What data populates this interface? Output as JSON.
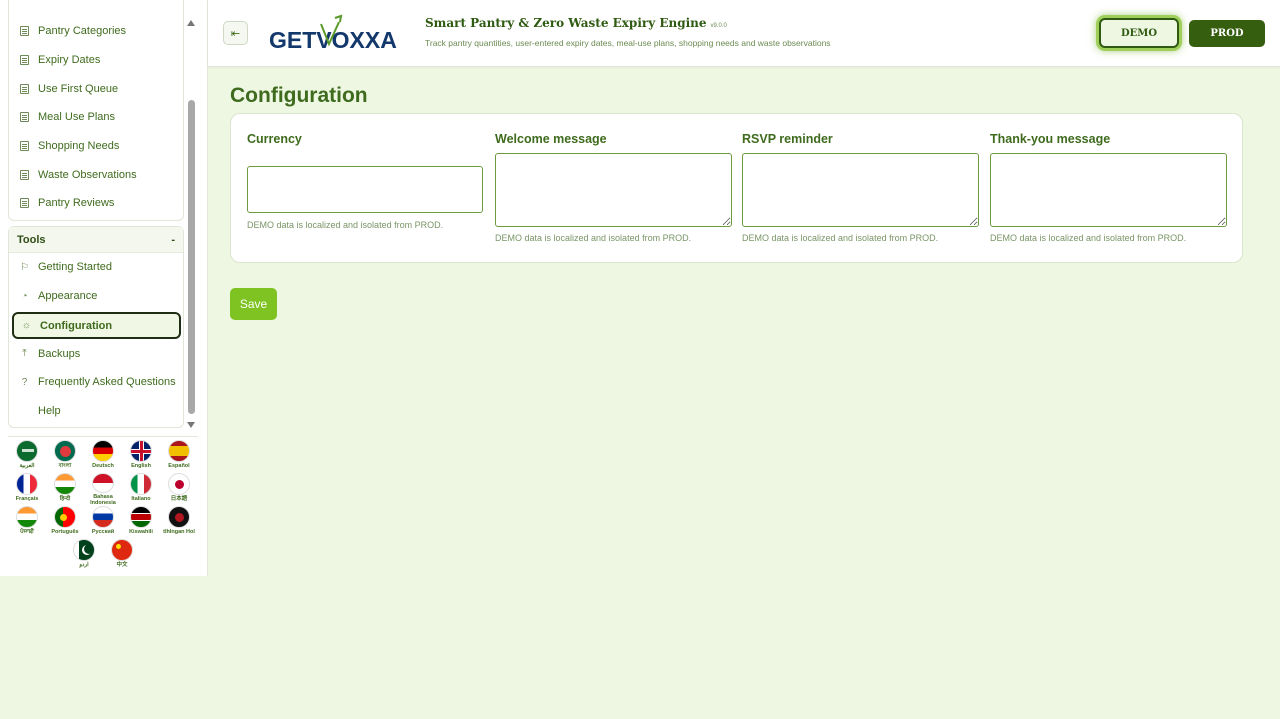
{
  "sidebar": {
    "items": [
      {
        "label": "Pantry Categories"
      },
      {
        "label": "Expiry Dates"
      },
      {
        "label": "Use First Queue"
      },
      {
        "label": "Meal Use Plans"
      },
      {
        "label": "Shopping Needs"
      },
      {
        "label": "Waste Observations"
      },
      {
        "label": "Pantry Reviews"
      }
    ],
    "tools": {
      "title": "Tools",
      "toggle": "-",
      "items": [
        {
          "label": "Getting Started"
        },
        {
          "label": "Appearance"
        },
        {
          "label": "Configuration"
        },
        {
          "label": "Backups"
        },
        {
          "label": "Frequently Asked Questions"
        },
        {
          "label": "Help"
        }
      ]
    },
    "languages": [
      {
        "label": "العربية"
      },
      {
        "label": "বাংলা"
      },
      {
        "label": "Deutsch"
      },
      {
        "label": "English"
      },
      {
        "label": "Español"
      },
      {
        "label": "Français"
      },
      {
        "label": "हिन्दी"
      },
      {
        "label": "Bahasa Indonesia"
      },
      {
        "label": "Italiano"
      },
      {
        "label": "日本語"
      },
      {
        "label": "ਪੰਜਾਬੀ"
      },
      {
        "label": "Português"
      },
      {
        "label": "Русский"
      },
      {
        "label": "Kiswahili"
      },
      {
        "label": "tlhIngan Hol"
      },
      {
        "label": "اردو"
      },
      {
        "label": "中文"
      }
    ]
  },
  "header": {
    "logo_text": "GETVOXXA",
    "title": "Smart Pantry & Zero Waste Expiry Engine",
    "version": "v9.0.0",
    "subtitle": "Track pantry quantities, user-entered expiry dates, meal-use plans, shopping needs and waste observations",
    "env_demo": "DEMO",
    "env_prod": "PROD"
  },
  "main": {
    "title": "Configuration",
    "fields": [
      {
        "label": "Currency",
        "value": "",
        "hint": "DEMO data is localized and isolated from PROD."
      },
      {
        "label": "Welcome message",
        "value": "",
        "hint": "DEMO data is localized and isolated from PROD."
      },
      {
        "label": "RSVP reminder",
        "value": "",
        "hint": "DEMO data is localized and isolated from PROD."
      },
      {
        "label": "Thank-you message",
        "value": "",
        "hint": "DEMO data is localized and isolated from PROD."
      }
    ],
    "save_label": "Save"
  },
  "colors": {
    "brand_dark": "#355e0e",
    "brand_green": "#3f6b1e",
    "accent": "#7ec321",
    "background": "#eef7e2"
  }
}
